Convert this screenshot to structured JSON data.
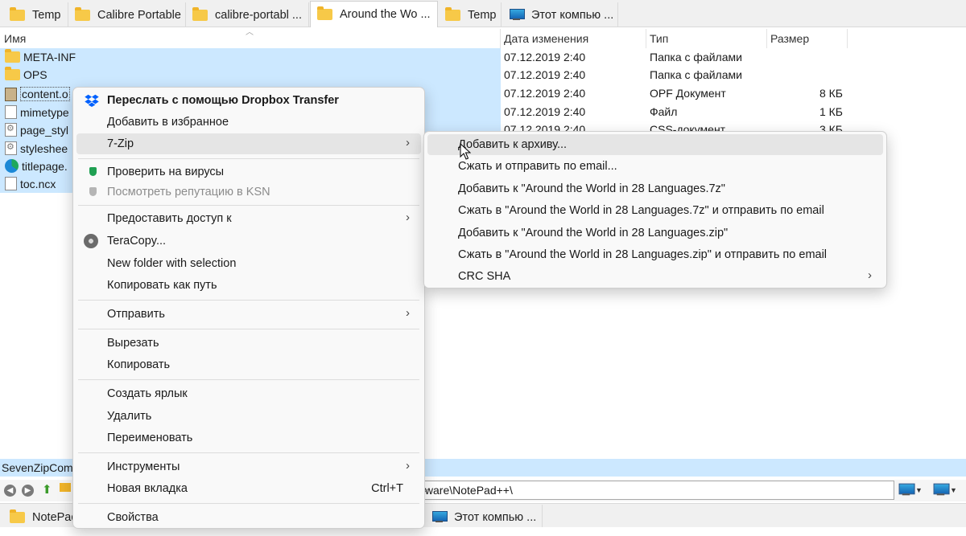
{
  "tabs_top": [
    {
      "label": "Temp",
      "icon": "folder-icon"
    },
    {
      "label": "Calibre Portable",
      "icon": "folder-icon"
    },
    {
      "label": "calibre-portabl ...",
      "icon": "folder-icon"
    },
    {
      "label": "Around the Wo ...",
      "icon": "folder-icon",
      "active": true
    },
    {
      "label": "Temp",
      "icon": "folder-icon"
    },
    {
      "label": "Этот компью ...",
      "icon": "computer-icon"
    }
  ],
  "columns": {
    "name": "Имя",
    "date": "Дата изменения",
    "type": "Тип",
    "size": "Размер"
  },
  "files": [
    {
      "name": "META-INF",
      "icon": "folder-icon",
      "date": "07.12.2019 2:40",
      "type": "Папка с файлами",
      "size": ""
    },
    {
      "name": "OPS",
      "icon": "folder-icon",
      "date": "07.12.2019 2:40",
      "type": "Папка с файлами",
      "size": ""
    },
    {
      "name": "content.o",
      "icon": "opf-file-icon",
      "date": "07.12.2019 2:40",
      "type": "OPF Документ",
      "size": "8 КБ"
    },
    {
      "name": "mimetype",
      "icon": "file-icon",
      "date": "07.12.2019 2:40",
      "type": "Файл",
      "size": "1 КБ"
    },
    {
      "name": "page_styl",
      "icon": "css-file-icon",
      "date": "07.12.2019 2:40",
      "type": "CSS-документ",
      "size": "3 КБ"
    },
    {
      "name": "styleshee",
      "icon": "css-file-icon",
      "date": "",
      "type": "",
      "size": ""
    },
    {
      "name": "titlepage.",
      "icon": "edge-icon",
      "date": "",
      "type": "",
      "size": ""
    },
    {
      "name": "toc.ncx",
      "icon": "file-icon",
      "date": "",
      "type": "",
      "size": ""
    }
  ],
  "bottom_panel": {
    "status_text": "SevenZipCom",
    "address_text": "tware\\NotePad++\\",
    "tabs": [
      {
        "label": "NotePad",
        "icon": "folder-icon"
      },
      {
        "label": "Этот компью ...",
        "icon": "computer-icon"
      }
    ]
  },
  "context_menu": {
    "items": [
      {
        "label": "Переслать с помощью Dropbox Transfer",
        "icon": "dropbox-icon",
        "bold": true
      },
      {
        "label": "Добавить в избранное"
      },
      {
        "label": "7-Zip",
        "submenu": true,
        "highlighted": true
      },
      {
        "label": "Проверить на вирусы",
        "icon": "kaspersky-shield-icon"
      },
      {
        "label": "Посмотреть репутацию в KSN",
        "icon": "kaspersky-shield-icon",
        "disabled": true
      },
      {
        "label": "Предоставить доступ к",
        "submenu": true
      },
      {
        "label": "TeraCopy...",
        "icon": "teracopy-icon"
      },
      {
        "label": "New folder with selection"
      },
      {
        "label": "Копировать как путь"
      },
      {
        "label": "Отправить",
        "submenu": true
      },
      {
        "label": "Вырезать"
      },
      {
        "label": "Копировать"
      },
      {
        "label": "Создать ярлык"
      },
      {
        "label": "Удалить"
      },
      {
        "label": "Переименовать"
      },
      {
        "label": "Инструменты",
        "submenu": true
      },
      {
        "label": "Новая вкладка",
        "shortcut": "Ctrl+T"
      },
      {
        "label": "Свойства"
      }
    ]
  },
  "zip_submenu": {
    "items": [
      {
        "label": "Добавить к архиву...",
        "highlighted": true
      },
      {
        "label": "Сжать и отправить по email..."
      },
      {
        "label": "Добавить к \"Around the World in 28 Languages.7z\""
      },
      {
        "label": "Сжать в \"Around the World in 28 Languages.7z\" и отправить по email"
      },
      {
        "label": "Добавить к \"Around the World in 28 Languages.zip\""
      },
      {
        "label": "Сжать в \"Around the World in 28 Languages.zip\" и отправить по email"
      },
      {
        "label": "CRC SHA",
        "submenu": true
      }
    ]
  },
  "colors": {
    "selection": "#cce8ff",
    "menu_bg": "#f9f9f9",
    "menu_highlight": "#e5e5e5",
    "dropbox": "#0061fe",
    "kaspersky": "#1fa052"
  }
}
